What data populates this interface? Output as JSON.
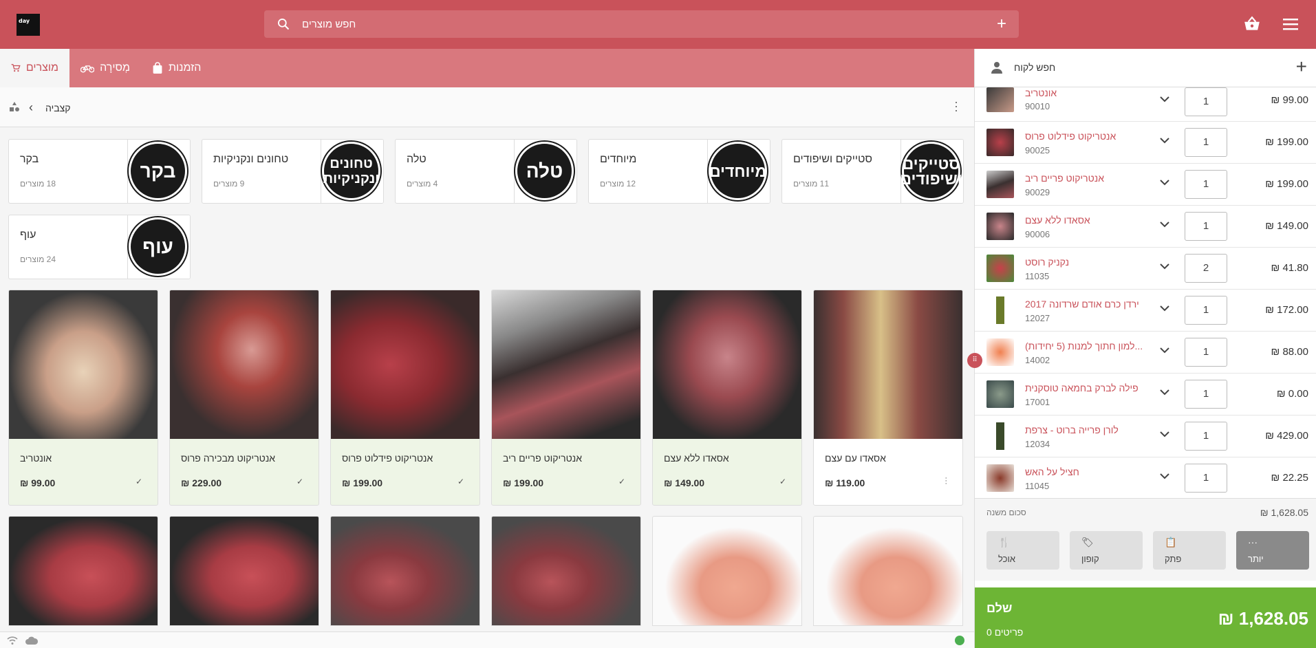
{
  "header": {
    "logo_text": "day",
    "search_placeholder": "חפש מוצרים",
    "colors": {
      "primary": "#c9525a",
      "pay": "#6db535"
    }
  },
  "tabs": [
    {
      "label": "מוצרים",
      "icon": "cart-icon",
      "active": true
    },
    {
      "label": "מְסירָה",
      "icon": "bicycle-icon",
      "active": false
    },
    {
      "label": "הזמנות",
      "icon": "bag-icon",
      "active": false
    }
  ],
  "breadcrumb": {
    "current": "קצביה"
  },
  "categories": [
    {
      "name": "סטייקים ושיפודים",
      "count": "11 מוצרים",
      "badge": "סטייקים ושיפודים"
    },
    {
      "name": "מיוחדים",
      "count": "12 מוצרים",
      "badge": "מיוחדים"
    },
    {
      "name": "טלה",
      "count": "4 מוצרים",
      "badge": "טלה"
    },
    {
      "name": "טחונים ונקניקיות",
      "count": "9 מוצרים",
      "badge": "טחונים ונקניקיות"
    },
    {
      "name": "בקר",
      "count": "18 מוצרים",
      "badge": "בקר"
    },
    {
      "name": "עוף",
      "count": "24 מוצרים",
      "badge": "עוף"
    }
  ],
  "products": [
    {
      "name": "אונטריב",
      "price": "₪ 99.00",
      "selected": true
    },
    {
      "name": "אנטריקוט מבכירה פרוס",
      "price": "₪ 229.00",
      "selected": true
    },
    {
      "name": "אנטריקוט פידלוט פרוס",
      "price": "₪ 199.00",
      "selected": true
    },
    {
      "name": "אנטריקוט פריים ריב",
      "price": "₪ 199.00",
      "selected": true
    },
    {
      "name": "אסאדו ללא עצם",
      "price": "₪ 149.00",
      "selected": true
    },
    {
      "name": "אסאדו עם עצם",
      "price": "₪ 119.00",
      "selected": false
    }
  ],
  "customer": {
    "label": "חפש לקוח"
  },
  "order_lines": [
    {
      "name": "אונטריב",
      "sku": "90010",
      "qty": "1",
      "price": "₪ 99.00"
    },
    {
      "name": "אנטריקוט פידלוט פרוס",
      "sku": "90025",
      "qty": "1",
      "price": "₪ 199.00"
    },
    {
      "name": "אנטריקוט פריים ריב",
      "sku": "90029",
      "qty": "1",
      "price": "₪ 199.00"
    },
    {
      "name": "אסאדו ללא עצם",
      "sku": "90006",
      "qty": "1",
      "price": "₪ 149.00"
    },
    {
      "name": "נקניק רוסט",
      "sku": "11035",
      "qty": "2",
      "price": "₪ 41.80"
    },
    {
      "name": "ירדן כרם אודם שרדונה 2017",
      "sku": "12027",
      "qty": "1",
      "price": "₪ 172.00"
    },
    {
      "name": "...למון חתוך למנות (5 יחידות)",
      "sku": "14002",
      "qty": "1",
      "price": "₪ 88.00"
    },
    {
      "name": "פילה לברק בחמאה טוסקנית",
      "sku": "17001",
      "qty": "1",
      "price": "₪ 0.00"
    },
    {
      "name": "לורן פרייה ברוט - צרפת",
      "sku": "12034",
      "qty": "1",
      "price": "₪ 429.00"
    },
    {
      "name": "חציל על האש",
      "sku": "11045",
      "qty": "1",
      "price": "₪ 22.25"
    }
  ],
  "subtotal": {
    "label": "סכום משנה",
    "value": "₪ 1,628.05"
  },
  "actions": [
    {
      "label": "אוכל",
      "icon": "utensils-icon"
    },
    {
      "label": "קופון",
      "icon": "tag-icon"
    },
    {
      "label": "פתק",
      "icon": "clipboard-icon"
    },
    {
      "label": "יותר",
      "icon": "more-icon"
    }
  ],
  "pay": {
    "label": "שלם",
    "items": "0 פריטים",
    "total": "₪ 1,628.05"
  }
}
